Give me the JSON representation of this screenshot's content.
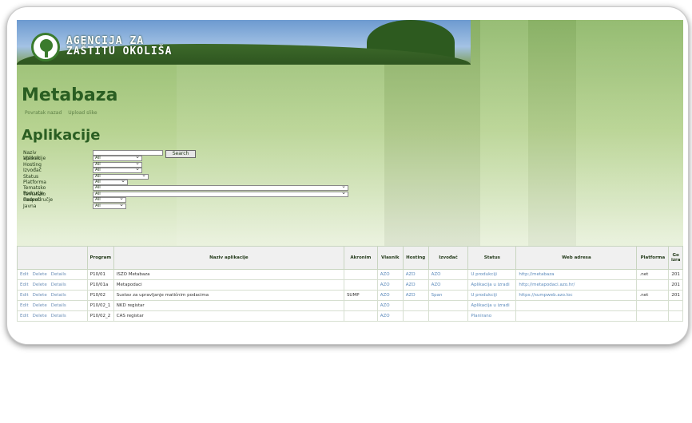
{
  "brand": {
    "line1": "AGENCIJA ZA",
    "line2": "ZAŠTITU OKOLIŠA"
  },
  "page": {
    "title": "Metabaza",
    "back_link": "Povratak nazad",
    "upload_link": "Upload slike",
    "section": "Aplikacije"
  },
  "filters": {
    "name_label": "Naziv aplikacije",
    "search_label": "Search",
    "rows": [
      {
        "label": "Vlasnik",
        "value": "All"
      },
      {
        "label": "Hosting",
        "value": "All"
      },
      {
        "label": "Izvođač",
        "value": "All"
      },
      {
        "label": "Status",
        "value": "All"
      },
      {
        "label": "Platforma",
        "value": "All"
      },
      {
        "label": "Tematsko Područje",
        "value": "All"
      },
      {
        "label": "Tematsko Podpodručje",
        "value": "All"
      },
      {
        "label": "Georef.",
        "value": "All"
      },
      {
        "label": "Javna",
        "value": "All"
      }
    ]
  },
  "table": {
    "headers": [
      "Program",
      "Naziv aplikacije",
      "Akronim",
      "Vlasnik",
      "Hosting",
      "Izvođač",
      "Status",
      "Web adresa",
      "Platforma",
      "Go izra"
    ],
    "actions": [
      "Edit",
      "Delete",
      "Details"
    ],
    "rows": [
      [
        "P10/01",
        "ISZO Metabaza",
        "",
        "AZO",
        "AZO",
        "AZO",
        "U produkciji",
        "http://metabaza",
        ".net",
        "201"
      ],
      [
        "P10/01a",
        "Metapodaci",
        "",
        "AZO",
        "AZO",
        "AZO",
        "Aplikacija u izradi",
        "http://metapodaci.azo.hr/",
        "",
        "201"
      ],
      [
        "P10/02",
        "Sustav za upravljanje matičnim podacima",
        "SUMP",
        "AZO",
        "AZO",
        "Span",
        "U produkciji",
        "https://sumpweb.azo.loc",
        ".net",
        "201"
      ],
      [
        "P10/02_1",
        "NKD registar",
        "",
        "AZO",
        "",
        "",
        "Aplikacija u izradi",
        "",
        "",
        ""
      ],
      [
        "P10/02_2",
        "CAS registar",
        "",
        "AZO",
        "",
        "",
        "Planirano",
        "",
        "",
        ""
      ]
    ]
  }
}
